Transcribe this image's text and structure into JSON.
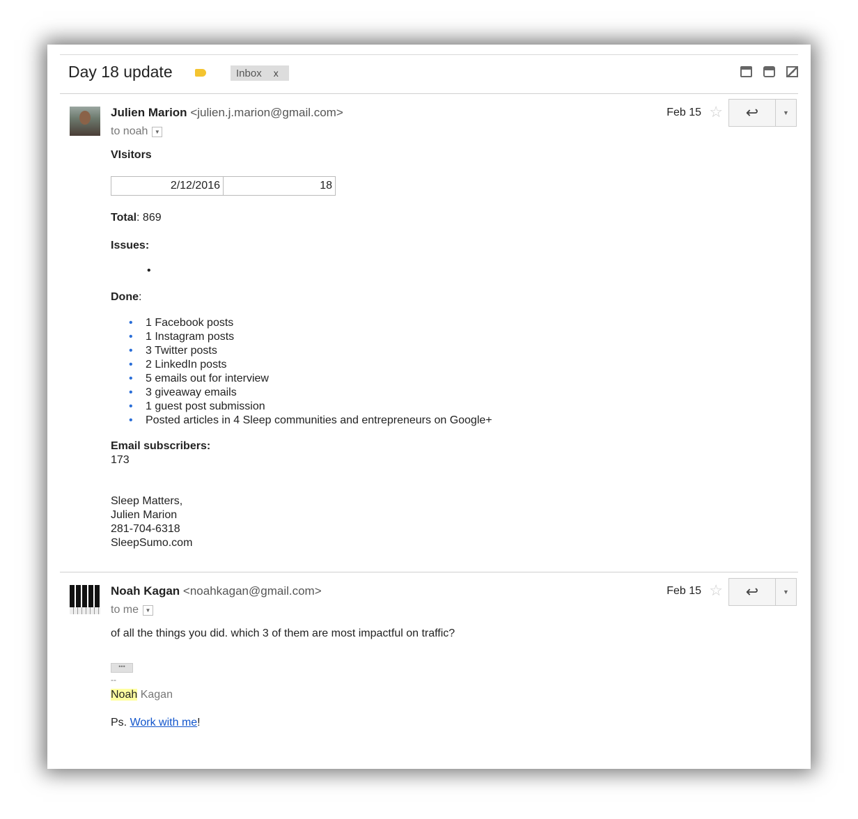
{
  "thread": {
    "subject": "Day 18 update",
    "label": "Inbox",
    "label_remove": "x",
    "icons": [
      "archive-icon",
      "print-icon",
      "new-window-icon"
    ]
  },
  "messages": [
    {
      "sender_name": "Julien Marion",
      "sender_email": "<julien.j.marion@gmail.com>",
      "recipient": "to noah",
      "date": "Feb 15",
      "star": "☆",
      "reply_icon": "↩",
      "more_icon": "▼",
      "visitors_title": "VIsitors",
      "visitors_table": {
        "date": "2/12/2016",
        "count": "18"
      },
      "total_label": "Total",
      "total_value": ": 869",
      "issues_label": "Issues:",
      "issues_bullet": "•",
      "done_label": "Done",
      "done_colon": ":",
      "done_items": [
        "1 Facebook posts",
        "1 Instagram posts",
        "3 Twitter posts",
        "2 LinkedIn posts",
        "5 emails out for interview",
        "3 giveaway emails",
        "1 guest post submission",
        "Posted articles in 4 Sleep communities and entrepreneurs on Google+"
      ],
      "subscribers_label": "Email subscribers:",
      "subscribers_value": "173",
      "signature": [
        "Sleep Matters,",
        "Julien Marion",
        "281-704-6318",
        "SleepSumo.com"
      ]
    },
    {
      "sender_name": "Noah Kagan",
      "sender_email": "<noahkagan@gmail.com>",
      "recipient": "to me",
      "date": "Feb 15",
      "star": "☆",
      "reply_icon": "↩",
      "more_icon": "▼",
      "text": "of all the things you did. which 3 of them are most impactful on traffic?",
      "ellipsis": "•••",
      "sig_dash": "--",
      "sig_first": "Noah",
      "sig_last": " Kagan",
      "ps_prefix": "Ps. ",
      "ps_link": "Work with me",
      "ps_suffix": "!"
    }
  ],
  "colors": {
    "label": "#f4c430",
    "link": "#1155cc",
    "bullet": "#2a6ed8",
    "highlight": "#ffffa0"
  }
}
